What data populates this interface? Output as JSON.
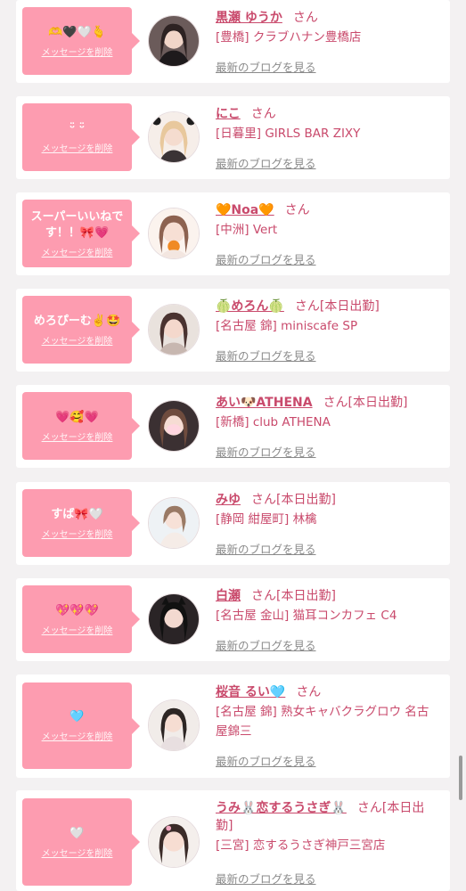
{
  "delete_label": "メッセージを削除",
  "blog_label": "最新のブログを見る",
  "san_suffix": "さん",
  "working_today": "[本日出勤]",
  "colors": {
    "bubble": "#fd9cb0",
    "name": "#c94a6c",
    "blog_link": "#8a8a8a",
    "card": "#ffffff"
  },
  "items": [
    {
      "message": "🫶🖤🤍🫰",
      "name": "黒瀬 ゆうか",
      "status": "さん",
      "shop": "[豊橋] クラブハナン豊橋店"
    },
    {
      "message": "ᵕ̈ ᵕ̈",
      "name": "にこ",
      "status": "さん",
      "shop": "[日暮里] GIRLS BAR ZIXY"
    },
    {
      "message": "スーパーいいねです！！🎀💗",
      "name": "🧡Noa🧡",
      "status": "さん",
      "shop": "[中洲] Vert"
    },
    {
      "message": "めろぴーむ✌️🤩",
      "name": "🍈めろん🍈",
      "status": "さん[本日出勤]",
      "shop": "[名古屋 錦] miniscafe SP"
    },
    {
      "message": "💗🥰💗",
      "name": "あい🐶ATHENA",
      "status": "さん[本日出勤]",
      "shop": "[新橋] club ATHENA"
    },
    {
      "message": "すば🎀🤍",
      "name": "みゆ",
      "status": "さん[本日出勤]",
      "shop": "[静岡 紺屋町] 林檎"
    },
    {
      "message": "💖💖💖",
      "name": "白瀬",
      "status": "さん[本日出勤]",
      "shop": "[名古屋 金山] 猫耳コンカフェ C4"
    },
    {
      "message": "🩵",
      "name": "桜音 るい🩵",
      "status": "さん",
      "shop": "[名古屋 錦] 熟女キャバクラグロウ 名古屋錦三"
    },
    {
      "message": "🤍",
      "name": "うみ🐰恋するうさぎ🐰",
      "status": "さん[本日出勤]",
      "shop": "[三宮] 恋するうさぎ神戸三宮店"
    }
  ]
}
